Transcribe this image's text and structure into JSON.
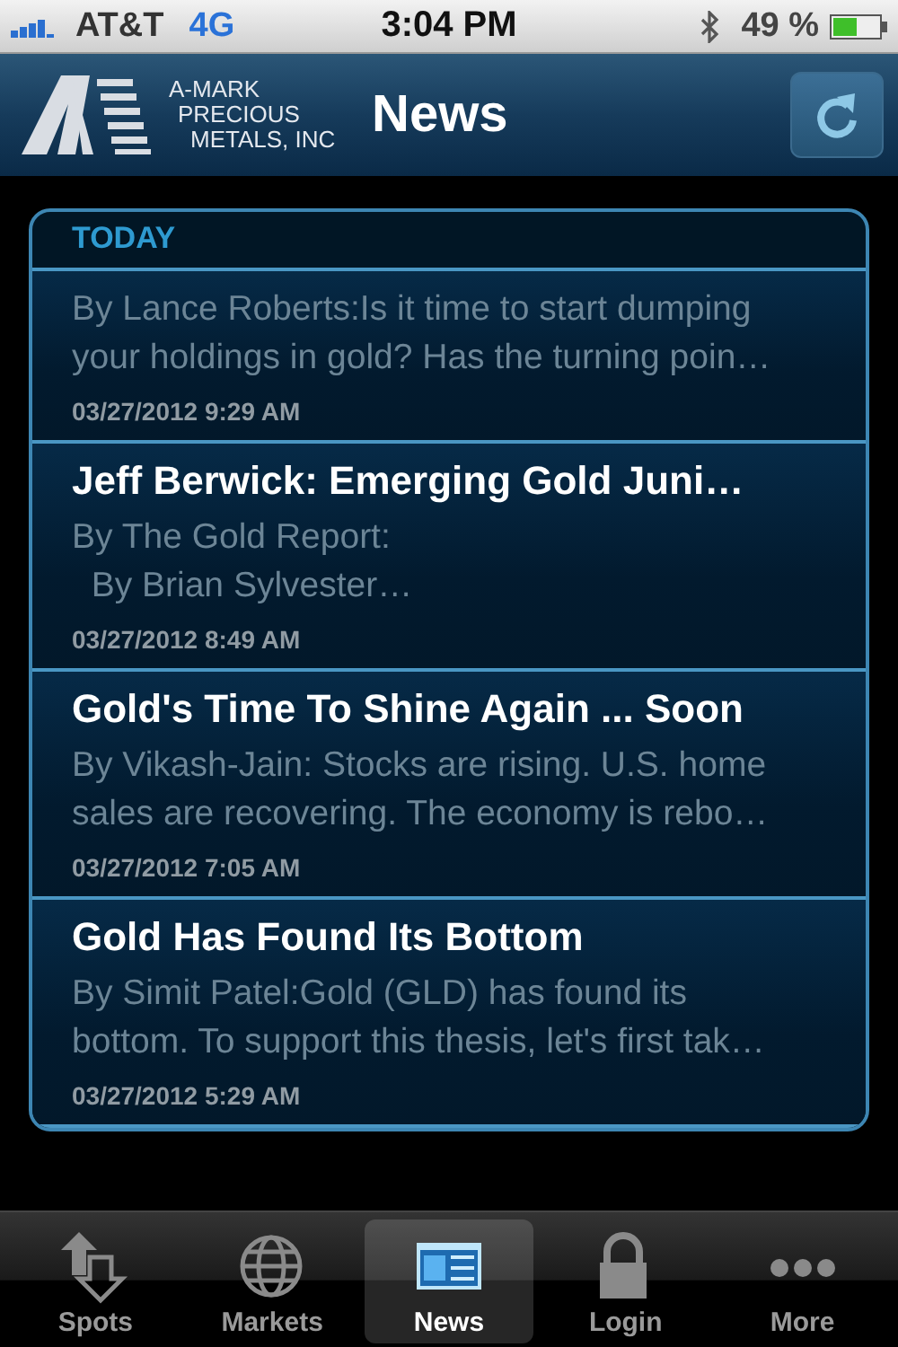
{
  "status_bar": {
    "carrier": "AT&T",
    "network": "4G",
    "time": "3:04 PM",
    "battery": "49 %"
  },
  "header": {
    "logo_lines": [
      "A-MARK",
      "PRECIOUS",
      "METALS, INC"
    ],
    "title": "News"
  },
  "section": {
    "heading": "TODAY"
  },
  "articles": [
    {
      "snippet": "By Lance Roberts:Is it time to start dumping\nyour holdings in gold? Has the turning poin…",
      "date": "03/27/2012 9:29 AM"
    },
    {
      "title": "Jeff Berwick: Emerging Gold Juni…",
      "snippet": "By The Gold Report:\n  By Brian Sylvester…",
      "date": "03/27/2012 8:49 AM"
    },
    {
      "title": "Gold's Time To Shine Again ... Soon",
      "snippet": "By Vikash-Jain: Stocks are rising. U.S. home\nsales are recovering. The economy is rebo…",
      "date": "03/27/2012 7:05 AM"
    },
    {
      "title": "Gold Has Found Its Bottom",
      "snippet": "By Simit Patel:Gold (GLD) has found its\nbottom. To support this thesis, let's first tak…",
      "date": "03/27/2012 5:29 AM"
    }
  ],
  "tabs": [
    {
      "kind": "spots",
      "label": "Spots",
      "selected": false
    },
    {
      "kind": "markets",
      "label": "Markets",
      "selected": false
    },
    {
      "kind": "news",
      "label": "News",
      "selected": true
    },
    {
      "kind": "login",
      "label": "Login",
      "selected": false
    },
    {
      "kind": "more",
      "label": "More",
      "selected": false
    }
  ]
}
